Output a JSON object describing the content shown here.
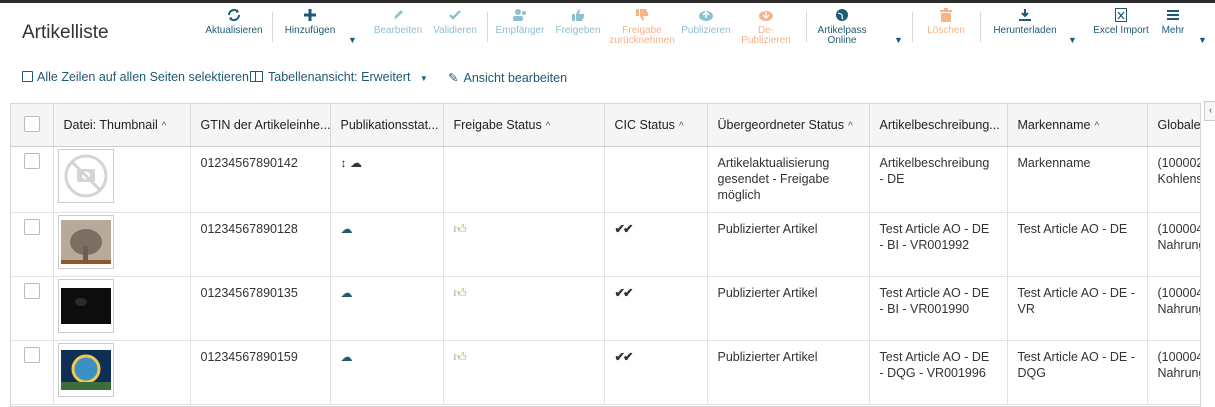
{
  "page_title": "Artikelliste",
  "toolbar": {
    "items": [
      {
        "label": "Aktualisieren",
        "icon": "refresh-icon",
        "enabled": true
      },
      {
        "label": "Hinzufügen",
        "icon": "plus-icon",
        "enabled": true
      },
      {
        "label": "Bearbeiten",
        "icon": "pencil-icon",
        "enabled": false
      },
      {
        "label": "Validieren",
        "icon": "check-icon",
        "enabled": false
      },
      {
        "label": "Empfänger",
        "icon": "users-icon",
        "enabled": false
      },
      {
        "label": "Freigeben",
        "icon": "thumbs-up-icon",
        "enabled": false
      },
      {
        "label": "Freigabe zurücknehmen",
        "label_line1": "Freigabe",
        "label_line2": "zurücknehmen",
        "icon": "thumbs-down-icon",
        "enabled": false
      },
      {
        "label": "Publizieren",
        "icon": "cloud-upload-icon",
        "enabled": false
      },
      {
        "label": "De-Publizieren",
        "label_line1": "De-",
        "label_line2": "Publizieren",
        "icon": "cloud-download-icon",
        "enabled": false
      },
      {
        "label": "Artikelpass Online",
        "label_line1": "Artikelpass",
        "label_line2": "Online",
        "icon": "globe-icon",
        "enabled": true
      },
      {
        "label": "Löschen",
        "icon": "trash-icon",
        "enabled": false
      },
      {
        "label": "Herunterladen",
        "icon": "download-icon",
        "enabled": true
      },
      {
        "label": "Excel Import",
        "icon": "excel-icon",
        "enabled": true
      },
      {
        "label": "Mehr",
        "icon": "menu-icon",
        "enabled": true
      }
    ]
  },
  "subbar": {
    "select_all": "Alle Zeilen auf allen Seiten selektieren",
    "table_view": "Tabellenansicht: Erweitert",
    "edit_view": "Ansicht bearbeiten"
  },
  "columns": [
    {
      "label": "Datei: Thumbnail",
      "sortable": true
    },
    {
      "label": "GTIN der Artikeleinhe...",
      "sortable": false
    },
    {
      "label": "Publikationsstat...",
      "sortable": false
    },
    {
      "label": "Freigabe Status",
      "sortable": true
    },
    {
      "label": "CIC Status",
      "sortable": true
    },
    {
      "label": "Übergeordneter Status",
      "sortable": true
    },
    {
      "label": "Artikelbeschreibung...",
      "sortable": false
    },
    {
      "label": "Markenname",
      "sortable": true
    },
    {
      "label": "Globale l",
      "sortable": false
    }
  ],
  "rows": [
    {
      "thumbnail": "placeholder",
      "gtin": "01234567890142",
      "pub_status": "sync-cloud",
      "freigabe": "",
      "cic": "",
      "parent_status": "Artikelaktualisierung gesendet - Freigabe möglich",
      "description": "Artikelbeschreibung - DE",
      "brand": "Markenname",
      "global_line1": "(100002",
      "global_line2": "Kohlens"
    },
    {
      "thumbnail": "elephant",
      "gtin": "01234567890128",
      "pub_status": "cloud",
      "freigabe": "like",
      "cic": "✔✔",
      "parent_status": "Publizierter Artikel",
      "description": "Test Article AO - DE - BI - VR001992",
      "brand": "Test Article AO - DE",
      "global_line1": "(100004",
      "global_line2": "Nahrung"
    },
    {
      "thumbnail": "dark",
      "gtin": "01234567890135",
      "pub_status": "cloud",
      "freigabe": "like",
      "cic": "✔✔",
      "parent_status": "Publizierter Artikel",
      "description": "Test Article AO - DE - BI - VR001990",
      "brand": "Test Article AO - DE - VR",
      "global_line1": "(100004",
      "global_line2": "Nahrung"
    },
    {
      "thumbnail": "ring",
      "gtin": "01234567890159",
      "pub_status": "cloud",
      "freigabe": "like",
      "cic": "✔✔",
      "parent_status": "Publizierter Artikel",
      "description": "Test Article AO - DE - DQG - VR001996",
      "brand": "Test Article AO - DE - DQG",
      "global_line1": "(100004",
      "global_line2": "Nahrung"
    }
  ],
  "colors": {
    "accent": "#1f5a73",
    "disabled": "#8fc0cf",
    "orange_disabled": "#f7b38a"
  }
}
